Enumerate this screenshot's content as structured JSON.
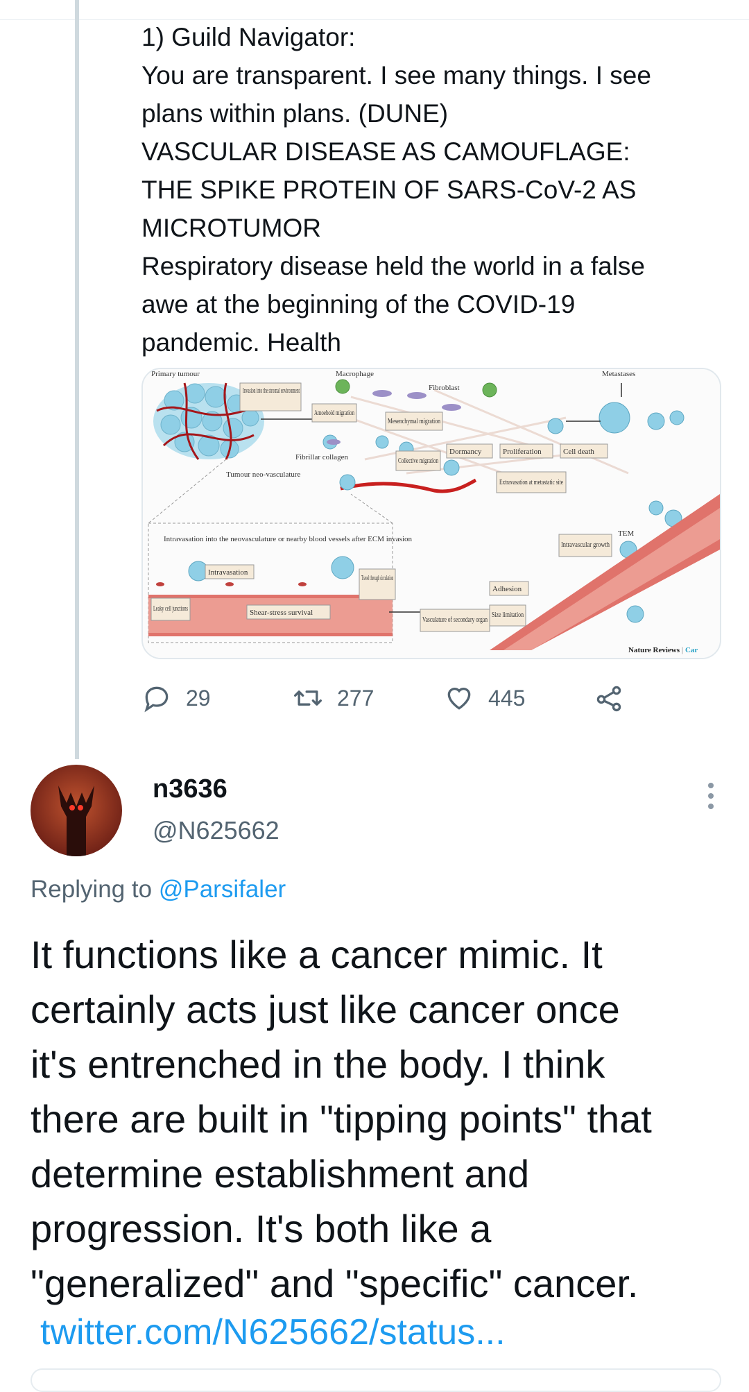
{
  "thread_tweet": {
    "lines": [
      "1) Guild Navigator:",
      "You are transparent. I see many things. I see",
      "plans within plans. (DUNE)",
      "VASCULAR DISEASE AS CAMOUFLAGE:",
      "THE SPIKE PROTEIN OF SARS-CoV-2 AS",
      "MICROTUMOR",
      "Respiratory disease held the world in a false",
      "awe at the beginning of the COVID-19",
      "pandemic. Health"
    ],
    "image": {
      "labels": {
        "primary_tumour": "Primary tumour",
        "macrophage": "Macrophage",
        "fibroblast": "Fibroblast",
        "metastases": "Metastases",
        "invasion": "Invasion into the stromal environment",
        "amoeboid": "Amoeboid migration",
        "mesenchymal": "Mesenchymal migration",
        "fibrillar": "Fibrillar collagen",
        "collective": "Collective migration",
        "neovasculature": "Tumour neo-vasculature",
        "dormancy": "Dormancy",
        "proliferation": "Proliferation",
        "cell_death": "Cell death",
        "extravasation": "Extravasation at metastatic site",
        "tem": "TEM",
        "intravasation_title": "Intravasation into the neovasculature or nearby blood vessels after ECM invasion",
        "intravasation": "Intravasation",
        "travel": "Travel through circulation",
        "intravascular": "Intravascular growth",
        "adhesion": "Adhesion",
        "leaky": "Leaky cell junctions",
        "shear": "Shear-stress survival",
        "vasculature": "Vasculature of secondary organ",
        "size": "Size limitation",
        "credit": "Nature Reviews",
        "credit_sep": " | ",
        "credit_tail": "Car"
      }
    },
    "actions": {
      "replies": "29",
      "retweets": "277",
      "likes": "445"
    }
  },
  "reply_tweet": {
    "name": "n3636",
    "handle": "@N625662",
    "replying_prefix": "Replying to ",
    "replying_to": "@Parsifaler",
    "lines": [
      "It functions like a cancer mimic. It",
      "certainly acts just like cancer once",
      "it's entrenched in the body.  I think",
      "there are built in \"tipping points\" that",
      "determine establishment and",
      "progression.  It's both like a",
      "\"generalized\" and \"specific\" cancer."
    ],
    "link": "twitter.com/N625662/status..."
  },
  "colors": {
    "accent": "#1d9bf0",
    "muted": "#536471",
    "vessel": "#e0736b",
    "cell": "#8fcfe6"
  },
  "icons": [
    "reply-icon",
    "retweet-icon",
    "like-icon",
    "share-icon",
    "more-icon"
  ]
}
